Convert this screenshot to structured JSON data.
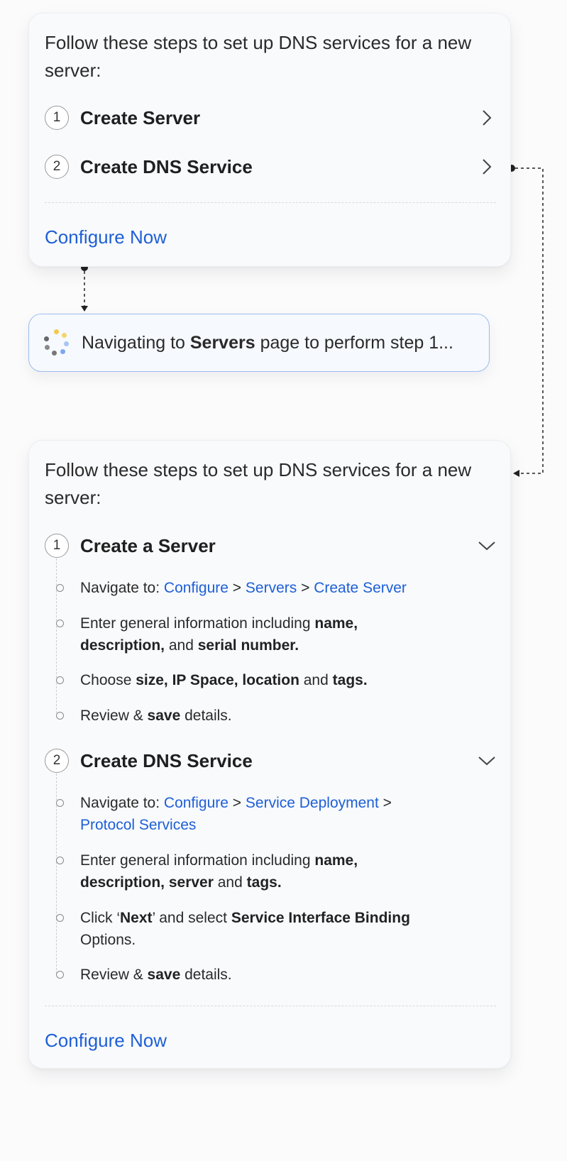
{
  "intro_text": "Follow these steps to set up DNS services for a new server:",
  "card_top": {
    "steps": [
      {
        "num": "1",
        "title": "Create Server"
      },
      {
        "num": "2",
        "title": "Create DNS Service"
      }
    ],
    "cta": "Configure Now"
  },
  "status": {
    "prefix": "Navigating to ",
    "bold": "Servers",
    "suffix": " page to perform step 1..."
  },
  "card_bottom": {
    "step1": {
      "num": "1",
      "title": "Create a Server",
      "item1": {
        "prefix": "Navigate to: ",
        "link1": "Configure",
        "sep1": " > ",
        "link2": "Servers",
        "sep2": " > ",
        "link3": "Create Server"
      },
      "item2": {
        "t1": "Enter general information including ",
        "b1": "name,",
        "b2": "description,",
        "t2": " and ",
        "b3": "serial number."
      },
      "item3": {
        "t1": "Choose ",
        "b1": "size, IP Space, location",
        "t2": " and ",
        "b2": "tags."
      },
      "item4": {
        "t1": "Review & ",
        "b1": "save",
        "t2": " details."
      }
    },
    "step2": {
      "num": "2",
      "title": "Create DNS Service",
      "item1": {
        "prefix": "Navigate to: ",
        "link1": "Configure",
        "sep1": " > ",
        "link2": "Service Deployment",
        "sep2": " >",
        "link3": "Protocol Services"
      },
      "item2": {
        "t1": "Enter general information including ",
        "b1": "name,",
        "b2": "description, server",
        "t2": " and ",
        "b3": "tags."
      },
      "item3": {
        "t1": "Click ‘",
        "b1": "Next",
        "t2": "’ and select ",
        "b2": "Service Interface Binding",
        "t3": "Options."
      },
      "item4": {
        "t1": "Review & ",
        "b1": "save",
        "t2": " details."
      }
    },
    "cta": "Configure Now"
  },
  "colors": {
    "link": "#1e5fd6",
    "status_border": "#9bbdf0"
  },
  "icons": [
    "chevron-right-icon",
    "chevron-down-icon",
    "loading-spinner-icon"
  ]
}
